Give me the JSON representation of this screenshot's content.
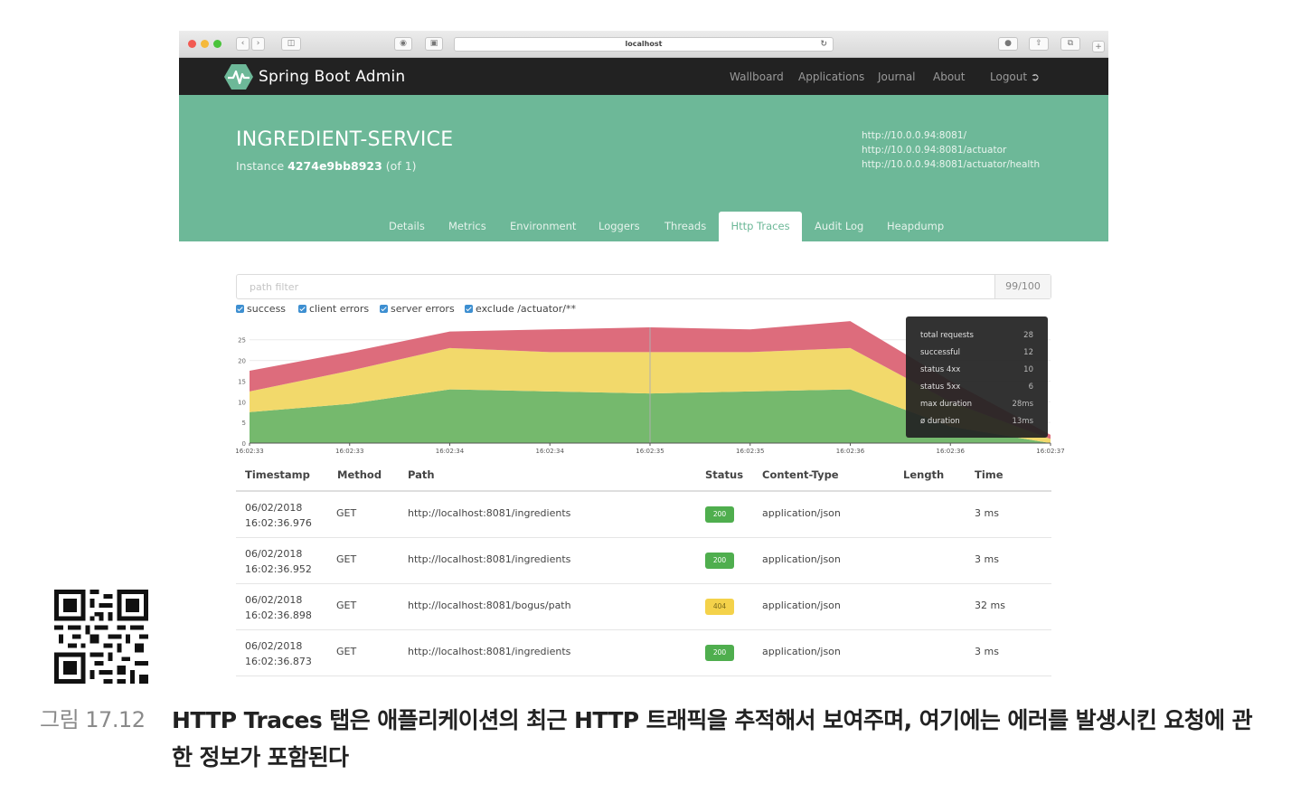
{
  "browser": {
    "url": "localhost"
  },
  "app": {
    "brand": "Spring Boot Admin",
    "nav": [
      "Wallboard",
      "Applications",
      "Journal",
      "About",
      "Logout"
    ]
  },
  "service": {
    "name": "INGREDIENT-SERVICE",
    "instance_label": "Instance",
    "instance_id": "4274e9bb8923",
    "instance_count": "(of 1)",
    "links": [
      "http://10.0.0.94:8081/",
      "http://10.0.0.94:8081/actuator",
      "http://10.0.0.94:8081/actuator/health"
    ]
  },
  "tabs": [
    "Details",
    "Metrics",
    "Environment",
    "Loggers",
    "Threads",
    "Http Traces",
    "Audit Log",
    "Heapdump"
  ],
  "active_tab": "Http Traces",
  "filter": {
    "placeholder": "path filter",
    "count": "99/100"
  },
  "checkboxes": [
    "success",
    "client errors",
    "server errors",
    "exclude /actuator/**"
  ],
  "chart_data": {
    "type": "area",
    "x": [
      "16:02:33",
      "16:02:33",
      "16:02:34",
      "16:02:34",
      "16:02:35",
      "16:02:35",
      "16:02:36",
      "16:02:36",
      "16:02:37"
    ],
    "yticks": [
      "0",
      "5",
      "10",
      "15",
      "20",
      "25"
    ],
    "ylim": [
      0,
      28
    ],
    "stacked": true,
    "series": [
      {
        "name": "successful",
        "color": "#75b96d",
        "values": [
          7.5,
          9.5,
          13,
          12.5,
          12,
          12.5,
          13,
          4,
          0
        ]
      },
      {
        "name": "status 4xx",
        "color": "#f2d96b",
        "values": [
          5,
          8,
          10,
          9.5,
          10,
          9.5,
          10,
          6,
          1
        ]
      },
      {
        "name": "status 5xx",
        "color": "#dd6c7c",
        "values": [
          5,
          4.5,
          4,
          5.5,
          6,
          5.5,
          6.5,
          5,
          1
        ]
      }
    ]
  },
  "tooltip": {
    "rows": [
      {
        "label": "total requests",
        "value": "28"
      },
      {
        "label": "successful",
        "value": "12"
      },
      {
        "label": "status 4xx",
        "value": "10"
      },
      {
        "label": "status 5xx",
        "value": "6"
      },
      {
        "label": "max duration",
        "value": "28ms"
      },
      {
        "label": "ø duration",
        "value": "13ms"
      }
    ]
  },
  "table": {
    "headers": [
      "Timestamp",
      "Method",
      "Path",
      "Status",
      "Content-Type",
      "Length",
      "Time"
    ],
    "rows": [
      {
        "date": "06/02/2018",
        "time": "16:02:36.976",
        "method": "GET",
        "path": "http://localhost:8081/ingredients",
        "status": "200",
        "content_type": "application/json",
        "length": "",
        "duration": "3 ms"
      },
      {
        "date": "06/02/2018",
        "time": "16:02:36.952",
        "method": "GET",
        "path": "http://localhost:8081/ingredients",
        "status": "200",
        "content_type": "application/json",
        "length": "",
        "duration": "3 ms"
      },
      {
        "date": "06/02/2018",
        "time": "16:02:36.898",
        "method": "GET",
        "path": "http://localhost:8081/bogus/path",
        "status": "404",
        "content_type": "application/json",
        "length": "",
        "duration": "32 ms"
      },
      {
        "date": "06/02/2018",
        "time": "16:02:36.873",
        "method": "GET",
        "path": "http://localhost:8081/ingredients",
        "status": "200",
        "content_type": "application/json",
        "length": "",
        "duration": "3 ms"
      }
    ]
  },
  "colors": {
    "header": "#6db898",
    "navbar": "#222222",
    "ok_badge": "#4fae4e",
    "warn_badge": "#f4d24a"
  },
  "caption": {
    "label": "그림 17.12",
    "text": "HTTP Traces 탭은 애플리케이션의 최근 HTTP 트래픽을 추적해서 보여주며, 여기에는 에러를 발생시킨 요청에 관한 정보가 포함된다"
  }
}
